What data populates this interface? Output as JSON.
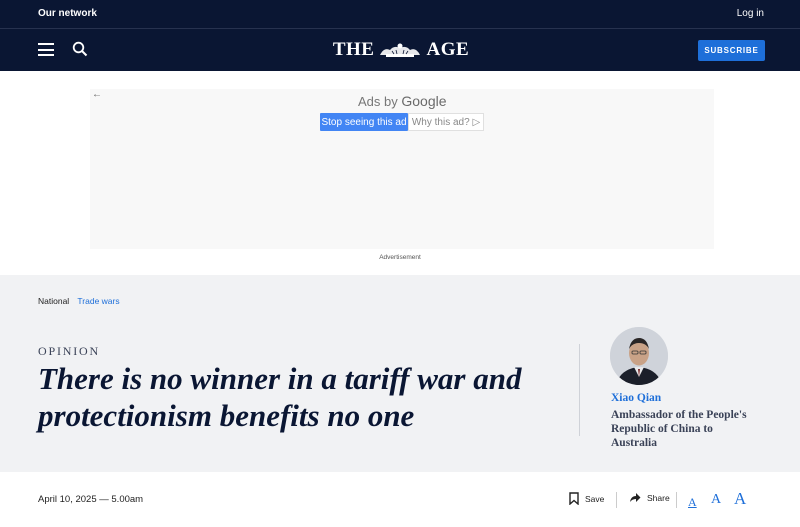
{
  "topbar": {
    "our_network": "Our network",
    "login": "Log in"
  },
  "masthead": {
    "logo_left": "THE",
    "logo_right": "AGE",
    "subscribe": "SUBSCRIBE",
    "icons": [
      "menu-icon",
      "search-icon",
      "crest-icon"
    ]
  },
  "ad": {
    "ads_by_prefix": "Ads by",
    "ads_by_brand": "Google",
    "stop_seeing": "Stop seeing this ad",
    "why_this_ad": "Why this ad? ▷",
    "back_arrow": "←",
    "label": "Advertisement"
  },
  "article": {
    "breadcrumb": {
      "section": "National",
      "topic": "Trade wars"
    },
    "kicker": "OPINION",
    "headline": "There is no winner in a tariff war and protectionism benefits no one",
    "author": {
      "name": "Xiao Qian",
      "role": "Ambassador of the People's Republic of China to Australia"
    },
    "dateline": "April 10, 2025 — 5.00am",
    "actions": {
      "save": "Save",
      "share": "Share"
    },
    "text_size": {
      "small": "A",
      "medium": "A",
      "large": "A"
    }
  },
  "colors": {
    "navy": "#0a1633",
    "accent_blue": "#1e6fd9",
    "band_bg": "#f1f2f4",
    "google_blue": "#4285f4"
  }
}
